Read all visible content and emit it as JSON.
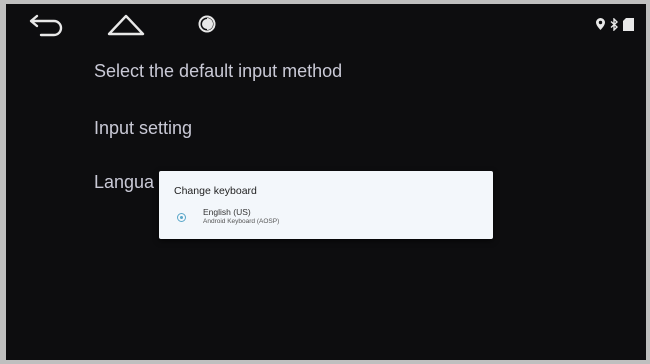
{
  "navbar": {
    "back_icon": "back-arrow-icon",
    "home_icon": "home-icon",
    "brightness_icon": "brightness-icon"
  },
  "status": {
    "icons": [
      "location-icon",
      "bluetooth-icon",
      "signal-icon"
    ]
  },
  "settings": {
    "items": [
      {
        "label": "Select the default input method"
      },
      {
        "label": "Input setting"
      },
      {
        "label": "Langua"
      }
    ]
  },
  "dialog": {
    "title": "Change keyboard",
    "option": {
      "name": "English (US)",
      "sub": "Android Keyboard (AOSP)",
      "selected": true
    }
  },
  "colors": {
    "screen_bg": "#0d0d0f",
    "menu_text": "#c9c9d6",
    "dialog_bg": "#f3f7fb",
    "accent": "#5aa7c9"
  }
}
